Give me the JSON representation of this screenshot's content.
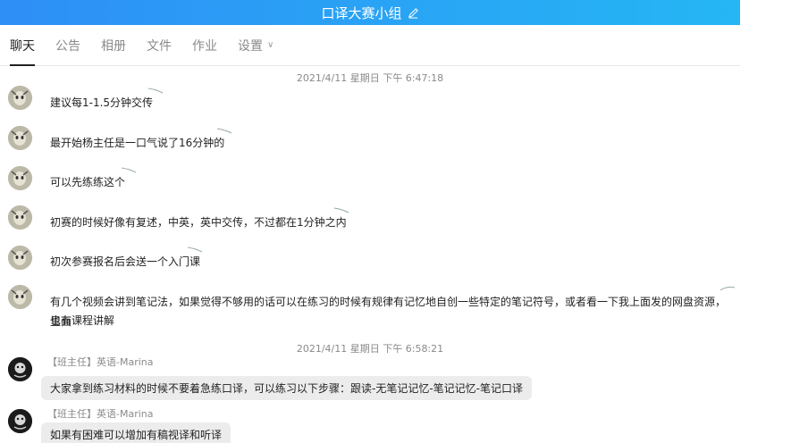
{
  "header": {
    "title": "口译大赛小组",
    "edit_icon": "edit-pencil-icon"
  },
  "tabs": [
    {
      "label": "聊天",
      "active": true
    },
    {
      "label": "公告"
    },
    {
      "label": "相册"
    },
    {
      "label": "文件"
    },
    {
      "label": "作业"
    },
    {
      "label": "设置"
    }
  ],
  "timestamps": [
    "2021/4/11 星期日 下午 6:47:18",
    "2021/4/11 星期日 下午 6:58:21"
  ],
  "messages_group1": [
    "建议每1-1.5分钟交传",
    "最开始杨主任是一口气说了16分钟的",
    "可以先练练这个",
    "初赛的时候好像有复述，中英，英中交传，不过都在1分钟之内",
    "初次参赛报名后会送一个入门课",
    "有几个视频会讲到笔记法，如果觉得不够用的话可以在练习的时候有规律有记忆地自创一些特定的笔记符号，或者看一下我上面发的网盘资源，里面",
    "也有课程讲解"
  ],
  "messages_group2": [
    {
      "sender": "【班主任】英语-Marina",
      "text": "大家拿到练习材料的时候不要着急练口译，可以练习以下步骤：跟读-无笔记记忆-笔记记忆-笔记口译"
    },
    {
      "sender": "【班主任】英语-Marina",
      "text": "如果有困难可以增加有稿视译和听译"
    }
  ],
  "colors": {
    "header_start": "#2e8ff6",
    "header_end": "#25b6f4",
    "bubble": "#ececec"
  }
}
